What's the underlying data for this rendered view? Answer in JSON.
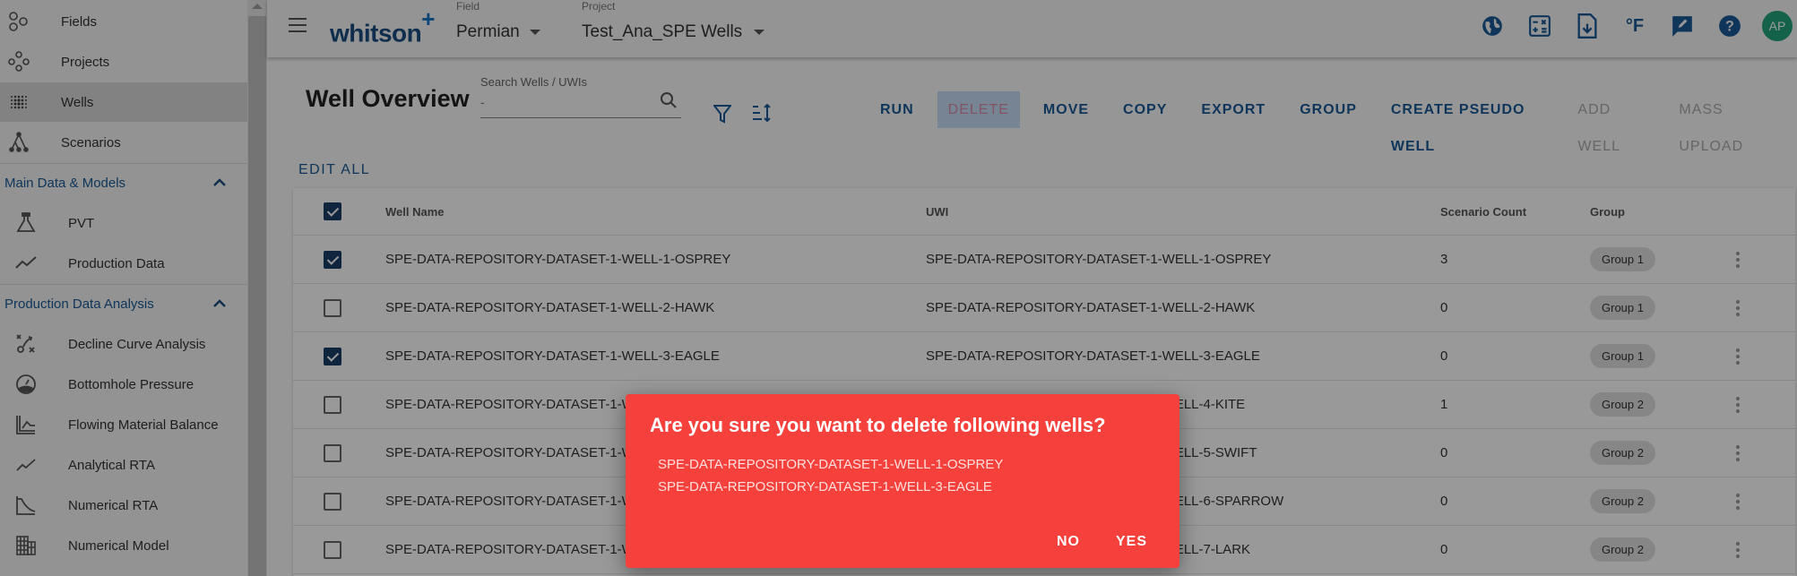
{
  "sidebar": {
    "items": [
      {
        "label": "Fields",
        "icon": "fields-icon"
      },
      {
        "label": "Projects",
        "icon": "projects-icon"
      },
      {
        "label": "Wells",
        "icon": "wells-icon",
        "active": true
      },
      {
        "label": "Scenarios",
        "icon": "scenarios-icon"
      }
    ],
    "sections": [
      {
        "title": "Main Data & Models",
        "expanded": true,
        "items": [
          {
            "label": "PVT",
            "icon": "flask-icon"
          },
          {
            "label": "Production Data",
            "icon": "line-chart-icon"
          }
        ]
      },
      {
        "title": "Production Data Analysis",
        "expanded": true,
        "items": [
          {
            "label": "Decline Curve Analysis",
            "icon": "decline-curve-icon"
          },
          {
            "label": "Bottomhole Pressure",
            "icon": "gauge-icon"
          },
          {
            "label": "Flowing Material Balance",
            "icon": "chart-axes-icon"
          },
          {
            "label": "Analytical RTA",
            "icon": "trend-icon"
          },
          {
            "label": "Numerical RTA",
            "icon": "decline-axes-icon"
          },
          {
            "label": "Numerical Model",
            "icon": "grid-model-icon"
          }
        ]
      }
    ]
  },
  "topbar": {
    "logo": "whitson",
    "logo_plus": "+",
    "field": {
      "caption": "Field",
      "value": "Permian"
    },
    "project": {
      "caption": "Project",
      "value": "Test_Ana_SPE Wells"
    },
    "icons": [
      "globe-icon",
      "calculator-icon",
      "file-download-icon",
      "fahrenheit-icon",
      "feedback-icon",
      "help-icon"
    ],
    "fahrenheit_label": "°F",
    "avatar": "AP",
    "avatar_color": "#23a47c"
  },
  "main": {
    "title": "Well Overview",
    "search": {
      "caption": "Search Wells / UWIs",
      "placeholder": "-"
    },
    "actions": [
      {
        "label": "RUN",
        "state": "enabled"
      },
      {
        "label": "DELETE",
        "state": "highlighted"
      },
      {
        "label": "MOVE",
        "state": "enabled"
      },
      {
        "label": "COPY",
        "state": "enabled"
      },
      {
        "label": "EXPORT",
        "state": "enabled"
      },
      {
        "label": "GROUP",
        "state": "enabled"
      },
      {
        "label": "CREATE PSEUDO WELL",
        "state": "enabled"
      },
      {
        "label": "ADD WELL",
        "state": "disabled"
      },
      {
        "label": "MASS UPLOAD",
        "state": "disabled"
      }
    ],
    "edit_all": "EDIT ALL",
    "table": {
      "columns": [
        "Well Name",
        "UWI",
        "Scenario Count",
        "Group"
      ],
      "header_checked": true,
      "rows": [
        {
          "checked": true,
          "name": "SPE-DATA-REPOSITORY-DATASET-1-WELL-1-OSPREY",
          "uwi": "SPE-DATA-REPOSITORY-DATASET-1-WELL-1-OSPREY",
          "count": "3",
          "group": "Group 1"
        },
        {
          "checked": false,
          "name": "SPE-DATA-REPOSITORY-DATASET-1-WELL-2-HAWK",
          "uwi": "SPE-DATA-REPOSITORY-DATASET-1-WELL-2-HAWK",
          "count": "0",
          "group": "Group 1"
        },
        {
          "checked": true,
          "name": "SPE-DATA-REPOSITORY-DATASET-1-WELL-3-EAGLE",
          "uwi": "SPE-DATA-REPOSITORY-DATASET-1-WELL-3-EAGLE",
          "count": "0",
          "group": "Group 1"
        },
        {
          "checked": false,
          "name": "SPE-DATA-REPOSITORY-DATASET-1-WELL-4-KITE",
          "uwi": "SPE-DATA-REPOSITORY-DATASET-1-WELL-4-KITE",
          "count": "1",
          "group": "Group 2"
        },
        {
          "checked": false,
          "name": "SPE-DATA-REPOSITORY-DATASET-1-WELL-5-SWIFT",
          "uwi": "SPE-DATA-REPOSITORY-DATASET-1-WELL-5-SWIFT",
          "count": "0",
          "group": "Group 2"
        },
        {
          "checked": false,
          "name": "SPE-DATA-REPOSITORY-DATASET-1-WELL-6-SPARROW",
          "uwi": "SPE-DATA-REPOSITORY-DATASET-1-WELL-6-SPARROW",
          "count": "0",
          "group": "Group 2"
        },
        {
          "checked": false,
          "name": "SPE-DATA-REPOSITORY-DATASET-1-WELL-7-LARK",
          "uwi": "SPE-DATA-REPOSITORY-DATASET-1-WELL-7-LARK",
          "count": "0",
          "group": "Group 2"
        }
      ]
    }
  },
  "dialog": {
    "title": "Are you sure you want to delete following wells?",
    "wells": [
      "SPE-DATA-REPOSITORY-DATASET-1-WELL-1-OSPREY",
      "SPE-DATA-REPOSITORY-DATASET-1-WELL-3-EAGLE"
    ],
    "no_label": "NO",
    "yes_label": "YES",
    "color": "#f6403c"
  }
}
